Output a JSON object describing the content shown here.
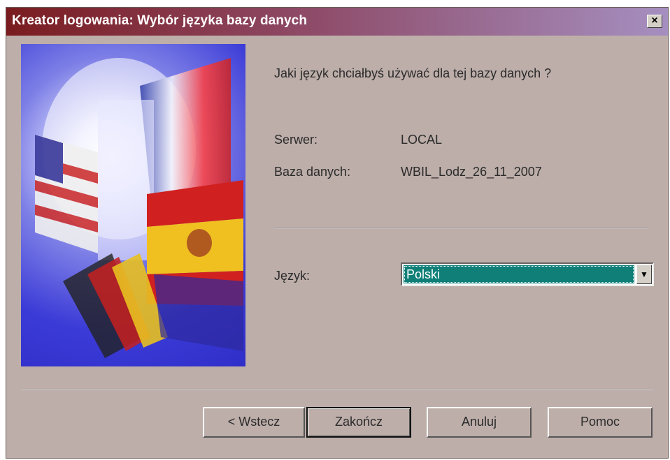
{
  "window": {
    "title": "Kreator logowania: Wybór języka bazy danych",
    "close_label": "×"
  },
  "question": "Jaki język chciałbyś używać dla tej bazy danych ?",
  "server": {
    "label": "Serwer:",
    "value": "LOCAL"
  },
  "database": {
    "label": "Baza danych:",
    "value": "WBIL_Lodz_26_11_2007"
  },
  "language": {
    "label": "Język:",
    "selected": "Polski"
  },
  "buttons": {
    "back": "< Wstecz",
    "finish": "Zakończ",
    "cancel": "Anuluj",
    "help": "Pomoc"
  },
  "colors": {
    "dialog_bg": "#bdaea9",
    "selection": "#0f7f78",
    "title_start": "#7a1c1f",
    "title_end": "#a58fc0"
  }
}
